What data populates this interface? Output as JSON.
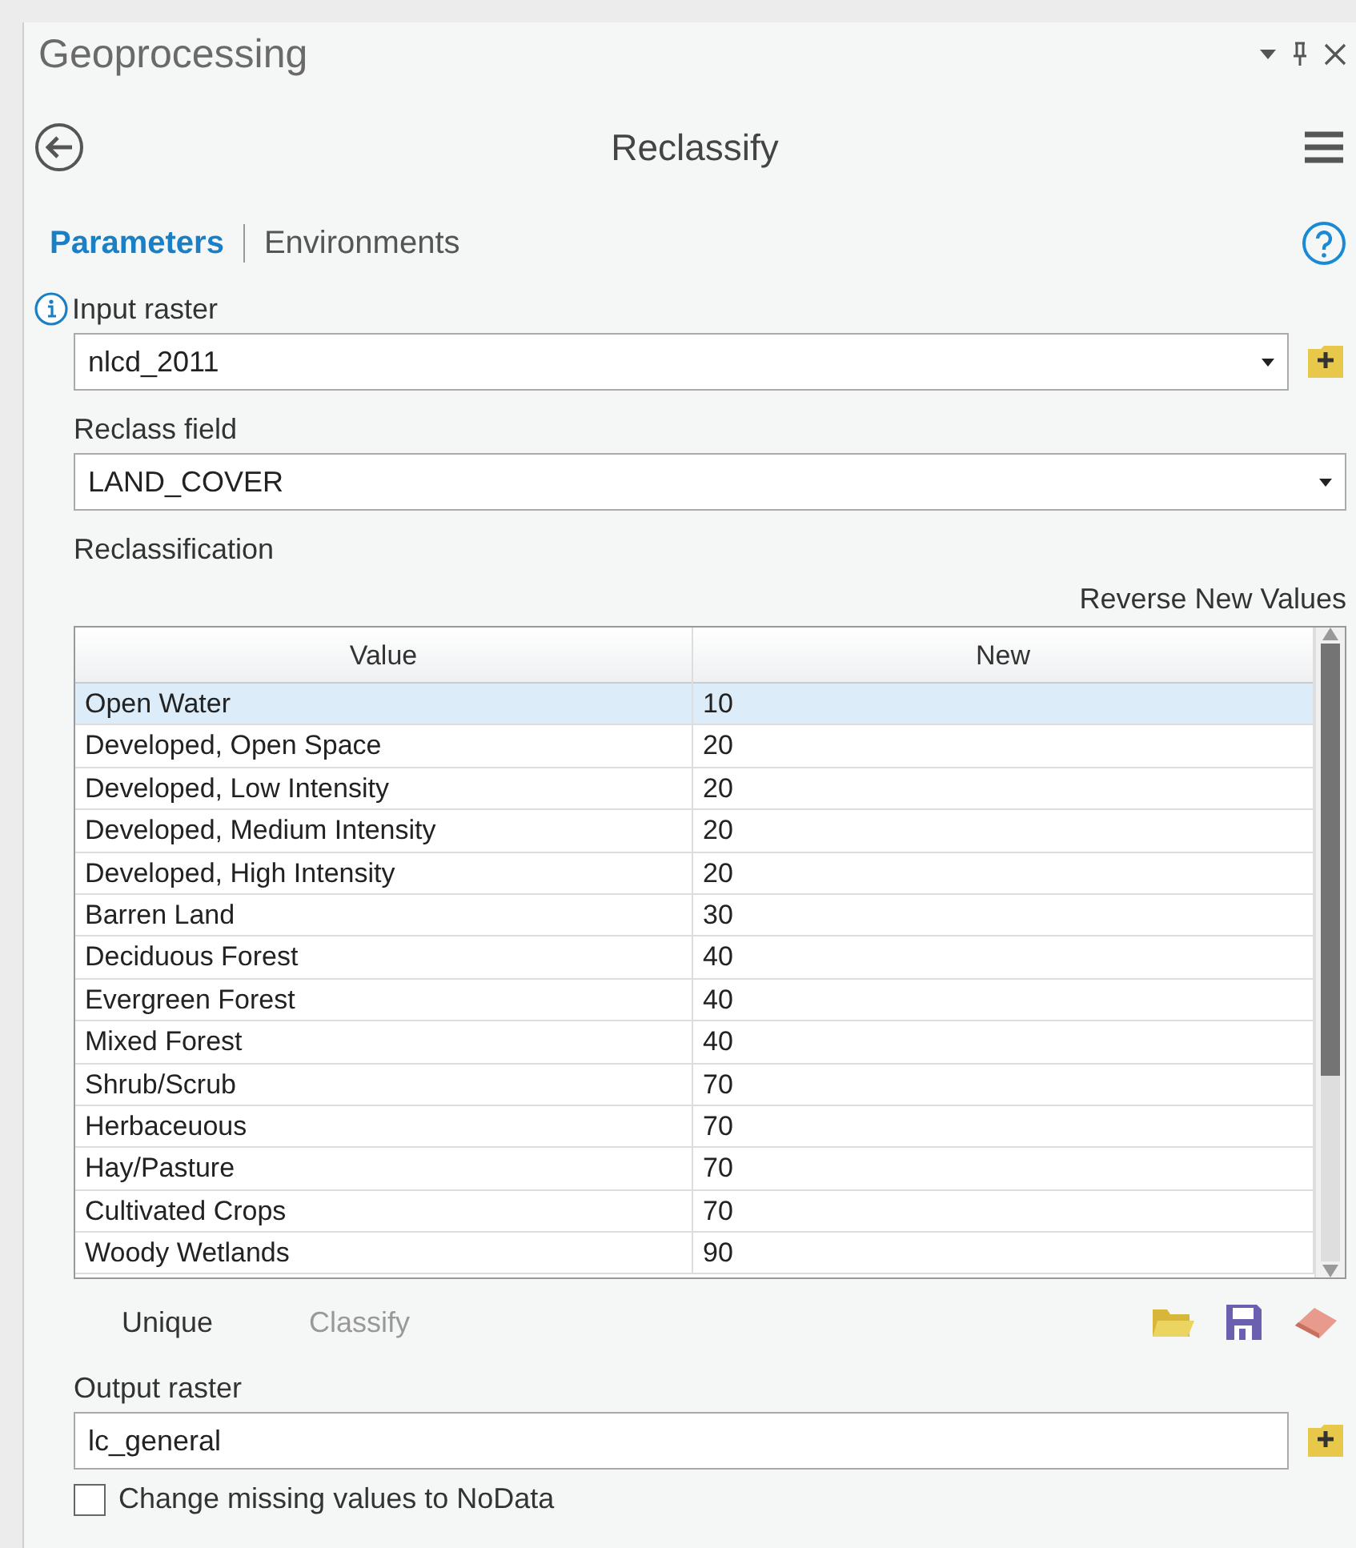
{
  "panel": {
    "title": "Geoprocessing"
  },
  "tool": {
    "title": "Reclassify"
  },
  "tabs": [
    {
      "label": "Parameters",
      "selected": true
    },
    {
      "label": "Environments",
      "selected": false
    }
  ],
  "input_raster": {
    "label": "Input raster",
    "value": "nlcd_2011"
  },
  "reclass_field": {
    "label": "Reclass field",
    "value": "LAND_COVER"
  },
  "reclassification": {
    "label": "Reclassification",
    "reverse_link": "Reverse New Values",
    "columns": [
      "Value",
      "New"
    ],
    "rows": [
      {
        "value": "Open Water",
        "new": "10",
        "selected": true
      },
      {
        "value": "Developed, Open Space",
        "new": "20",
        "selected": false
      },
      {
        "value": "Developed, Low Intensity",
        "new": "20",
        "selected": false
      },
      {
        "value": "Developed, Medium Intensity",
        "new": "20",
        "selected": false
      },
      {
        "value": "Developed, High Intensity",
        "new": "20",
        "selected": false
      },
      {
        "value": "Barren Land",
        "new": "30",
        "selected": false
      },
      {
        "value": "Deciduous Forest",
        "new": "40",
        "selected": false
      },
      {
        "value": "Evergreen Forest",
        "new": "40",
        "selected": false
      },
      {
        "value": "Mixed Forest",
        "new": "40",
        "selected": false
      },
      {
        "value": "Shrub/Scrub",
        "new": "70",
        "selected": false
      },
      {
        "value": "Herbaceuous",
        "new": "70",
        "selected": false
      },
      {
        "value": "Hay/Pasture",
        "new": "70",
        "selected": false
      },
      {
        "value": "Cultivated Crops",
        "new": "70",
        "selected": false
      },
      {
        "value": "Woody Wetlands",
        "new": "90",
        "selected": false
      }
    ],
    "buttons": [
      {
        "label": "Unique",
        "disabled": false
      },
      {
        "label": "Classify",
        "disabled": true
      }
    ]
  },
  "output_raster": {
    "label": "Output raster",
    "value": "lc_general"
  },
  "options": [
    {
      "label": "Change missing values to NoData",
      "checked": false
    }
  ]
}
